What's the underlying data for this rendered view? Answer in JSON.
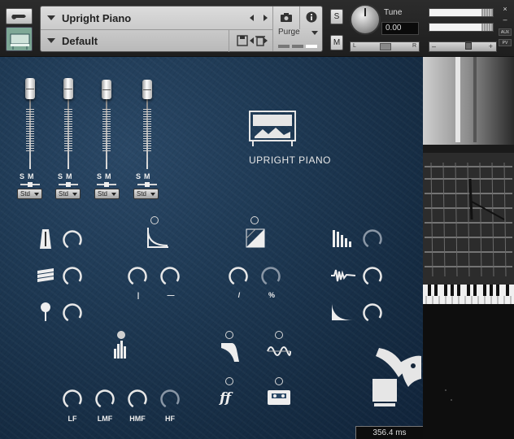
{
  "header": {
    "instrument_name": "Upright Piano",
    "preset_name": "Default",
    "purge_label": "Purge",
    "solo_label": "S",
    "mute_label": "M",
    "tune_label": "Tune",
    "tune_value": "0.00",
    "pan_left": "L",
    "pan_right": "R",
    "vol_minus": "–",
    "vol_plus": "+",
    "aux_label": "AUX",
    "pv_label": "PV",
    "close_glyph": "×",
    "minimize_glyph": "–"
  },
  "mixer": {
    "channels": [
      {
        "solo": "S",
        "mute": "M",
        "mode": "Std"
      },
      {
        "solo": "S",
        "mute": "M",
        "mode": "Std"
      },
      {
        "solo": "S",
        "mute": "M",
        "mode": "Std"
      },
      {
        "solo": "S",
        "mute": "M",
        "mode": "Std"
      }
    ]
  },
  "logo": {
    "title": "UPRIGHT PIANO"
  },
  "eq": {
    "labels": [
      "LF",
      "LMF",
      "HMF",
      "HF"
    ]
  },
  "small_labels": {
    "pre_delay": "|",
    "decay": "—",
    "curve": "/",
    "percent": "%"
  },
  "status": {
    "time_value": "356.4 ms"
  },
  "colors": {
    "accent_blue": "#1f3a55",
    "panel_gray": "#c8c8c8"
  }
}
